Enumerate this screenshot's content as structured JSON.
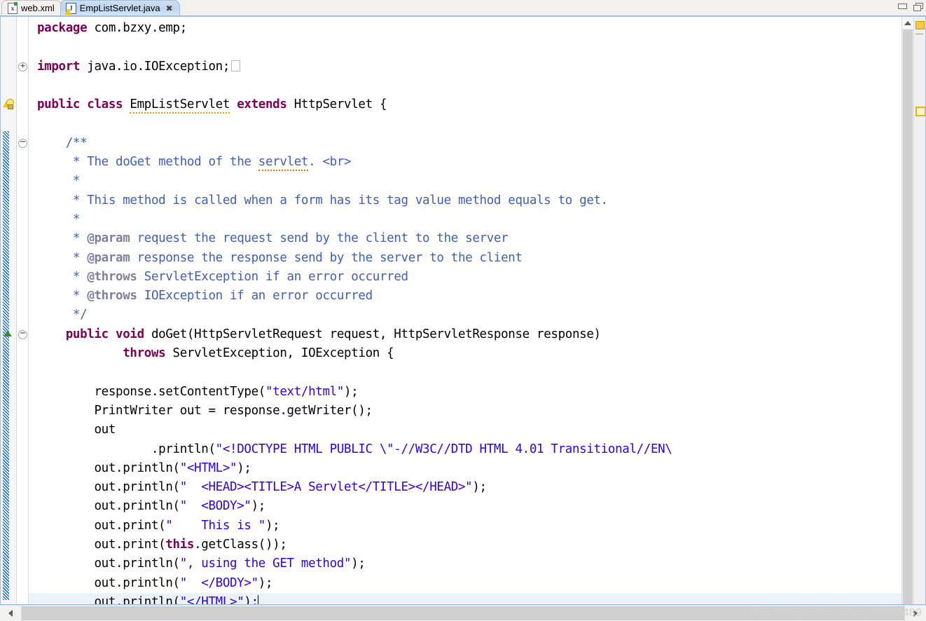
{
  "window": {
    "minimize_label": "Minimize",
    "maximize_label": "Maximize"
  },
  "tabs": [
    {
      "label": "web.xml",
      "icon": "xml-file-icon",
      "active": false,
      "closable": false
    },
    {
      "label": "EmpListServlet.java",
      "icon": "java-file-warning-icon",
      "active": true,
      "closable": true,
      "close_glyph": "✖"
    }
  ],
  "editor": {
    "file": "EmpListServlet.java",
    "current_line_index": 29,
    "caret_visible": true,
    "colors": {
      "keyword": "#7F0055",
      "javadoc": "#3F5FBF",
      "javadoc_tag": "#7F7F9F",
      "string": "#2A00FF",
      "plain": "#000000",
      "current_line_bg": "#EAF2FB",
      "warning_squiggle": "#D9A300",
      "spell_squiggle": "#E07B00",
      "change_bar": "#1F6FC4",
      "overview_warning": "#F7C83A"
    },
    "lines": [
      {
        "n": 1,
        "tokens": [
          {
            "t": "kw",
            "v": "package"
          },
          {
            "t": "plain",
            "v": " com.bzxy.emp;"
          }
        ]
      },
      {
        "n": 2,
        "tokens": []
      },
      {
        "n": 3,
        "tokens": [
          {
            "t": "kw",
            "v": "import"
          },
          {
            "t": "plain",
            "v": " java.io.IOException;"
          },
          {
            "t": "collapsed-imports",
            "v": ""
          }
        ]
      },
      {
        "n": 4,
        "tokens": []
      },
      {
        "n": 5,
        "tokens": [
          {
            "t": "kw",
            "v": "public class "
          },
          {
            "t": "squig",
            "v": "EmpListServlet"
          },
          {
            "t": "kw",
            "v": " extends "
          },
          {
            "t": "plain",
            "v": "HttpServlet {"
          }
        ]
      },
      {
        "n": 6,
        "tokens": []
      },
      {
        "n": 7,
        "tokens": [
          {
            "t": "doc",
            "v": "    /**"
          }
        ]
      },
      {
        "n": 8,
        "tokens": [
          {
            "t": "doc",
            "v": "     * The doGet method of the "
          },
          {
            "t": "doc-spell",
            "v": "servlet"
          },
          {
            "t": "doc",
            "v": ". <br>"
          }
        ]
      },
      {
        "n": 9,
        "tokens": [
          {
            "t": "doc",
            "v": "     *"
          }
        ]
      },
      {
        "n": 10,
        "tokens": [
          {
            "t": "doc",
            "v": "     * This method is called when a form has its tag value method equals to get."
          }
        ]
      },
      {
        "n": 11,
        "tokens": [
          {
            "t": "doc",
            "v": "     *"
          }
        ]
      },
      {
        "n": 12,
        "tokens": [
          {
            "t": "doc",
            "v": "     * "
          },
          {
            "t": "doct",
            "v": "@param"
          },
          {
            "t": "doc",
            "v": " request the request send by the client to the server"
          }
        ]
      },
      {
        "n": 13,
        "tokens": [
          {
            "t": "doc",
            "v": "     * "
          },
          {
            "t": "doct",
            "v": "@param"
          },
          {
            "t": "doc",
            "v": " response the response send by the server to the client"
          }
        ]
      },
      {
        "n": 14,
        "tokens": [
          {
            "t": "doc",
            "v": "     * "
          },
          {
            "t": "doct",
            "v": "@throws"
          },
          {
            "t": "doc",
            "v": " ServletException if an error occurred"
          }
        ]
      },
      {
        "n": 15,
        "tokens": [
          {
            "t": "doc",
            "v": "     * "
          },
          {
            "t": "doct",
            "v": "@throws"
          },
          {
            "t": "doc",
            "v": " IOException if an error occurred"
          }
        ]
      },
      {
        "n": 16,
        "tokens": [
          {
            "t": "doc",
            "v": "     */"
          }
        ]
      },
      {
        "n": 17,
        "tokens": [
          {
            "t": "kw",
            "v": "    public void "
          },
          {
            "t": "plain",
            "v": "doGet(HttpServletRequest request, HttpServletResponse response)"
          }
        ]
      },
      {
        "n": 18,
        "tokens": [
          {
            "t": "kw",
            "v": "            throws "
          },
          {
            "t": "plain",
            "v": "ServletException, IOException {"
          }
        ]
      },
      {
        "n": 19,
        "tokens": []
      },
      {
        "n": 20,
        "tokens": [
          {
            "t": "plain",
            "v": "        response.setContentType("
          },
          {
            "t": "str",
            "v": "\"text/html\""
          },
          {
            "t": "plain",
            "v": ");"
          }
        ]
      },
      {
        "n": 21,
        "tokens": [
          {
            "t": "plain",
            "v": "        PrintWriter out = response.getWriter();"
          }
        ]
      },
      {
        "n": 22,
        "tokens": [
          {
            "t": "plain",
            "v": "        out"
          }
        ]
      },
      {
        "n": 23,
        "tokens": [
          {
            "t": "plain",
            "v": "                .println("
          },
          {
            "t": "str",
            "v": "\"<!DOCTYPE HTML PUBLIC \\\"-//W3C//DTD HTML 4.01 Transitional//EN\\"
          }
        ]
      },
      {
        "n": 24,
        "tokens": [
          {
            "t": "plain",
            "v": "        out.println("
          },
          {
            "t": "str",
            "v": "\"<HTML>\""
          },
          {
            "t": "plain",
            "v": ");"
          }
        ]
      },
      {
        "n": 25,
        "tokens": [
          {
            "t": "plain",
            "v": "        out.println("
          },
          {
            "t": "str",
            "v": "\"  <HEAD><TITLE>A Servlet</TITLE></HEAD>\""
          },
          {
            "t": "plain",
            "v": ");"
          }
        ]
      },
      {
        "n": 26,
        "tokens": [
          {
            "t": "plain",
            "v": "        out.println("
          },
          {
            "t": "str",
            "v": "\"  <BODY>\""
          },
          {
            "t": "plain",
            "v": ");"
          }
        ]
      },
      {
        "n": 27,
        "tokens": [
          {
            "t": "plain",
            "v": "        out.print("
          },
          {
            "t": "str",
            "v": "\"    This is \""
          },
          {
            "t": "plain",
            "v": ");"
          }
        ]
      },
      {
        "n": 28,
        "tokens": [
          {
            "t": "plain",
            "v": "        out.print("
          },
          {
            "t": "kw",
            "v": "this"
          },
          {
            "t": "plain",
            "v": ".getClass());"
          }
        ]
      },
      {
        "n": 29,
        "tokens": [
          {
            "t": "plain",
            "v": "        out.println("
          },
          {
            "t": "str",
            "v": "\", using the GET method\""
          },
          {
            "t": "plain",
            "v": ");"
          }
        ]
      },
      {
        "n": 30,
        "tokens": [
          {
            "t": "plain",
            "v": "        out.println("
          },
          {
            "t": "str",
            "v": "\"  </BODY>\""
          },
          {
            "t": "plain",
            "v": ");"
          }
        ]
      },
      {
        "n": 31,
        "tokens": [
          {
            "t": "plain",
            "v": "        out.println("
          },
          {
            "t": "str",
            "v": "\"</HTML>\""
          },
          {
            "t": "plain",
            "v": ");"
          },
          {
            "t": "caret",
            "v": ""
          }
        ]
      }
    ],
    "gutter": {
      "folding_markers": [
        {
          "type": "plus",
          "line": 3
        },
        {
          "type": "minus",
          "line": 7
        },
        {
          "type": "minus",
          "line": 17
        }
      ],
      "annotations": [
        {
          "type": "warning-bulb-icon",
          "line": 5
        },
        {
          "type": "up-arrow-icon",
          "line": 17
        }
      ],
      "change_bar_from_line": 7
    },
    "overview_ruler": {
      "markers": [
        {
          "type": "warning-filled",
          "pos_pct": 2
        },
        {
          "type": "warning-hollow",
          "pos_pct": 43
        }
      ]
    },
    "vertical_scrollbar": {
      "up_arrow": "scroll-up-icon",
      "thumb_visible": true
    },
    "horizontal_scrollbar": {
      "left_arrow": "scroll-left-icon",
      "right_arrow": "scroll-right-icon"
    }
  },
  "watermark": "https://blog.csdn.net/qq_44458489"
}
